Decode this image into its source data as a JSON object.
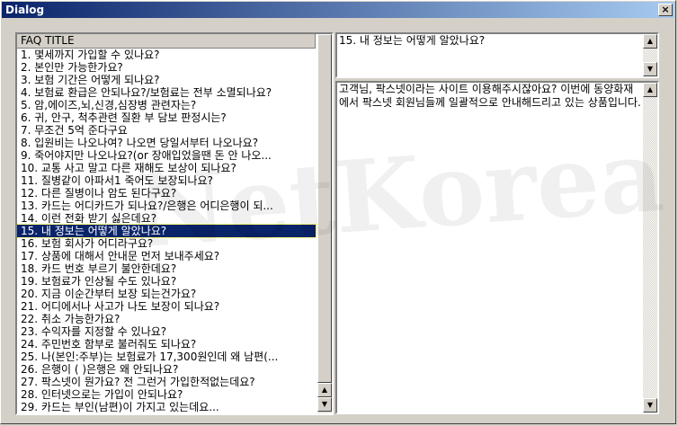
{
  "window": {
    "title": "Dialog",
    "close_glyph": "×"
  },
  "faq_list": {
    "header": "FAQ TITLE",
    "items": [
      "1. 몇세까지 가입할 수 있나요?",
      "2. 본인만 가능한가요?",
      "3. 보험 기간은 어떻게 되나요?",
      "4. 보험료 환급은 안되나요?/보험료는 전부 소멸되나요?",
      "5. 암,에이즈,뇌,신경,심장병 관련자는?",
      "6. 귀, 안구, 척추관련 질환 부 담보 판정시는?",
      "7. 무조건 5억 준다구요",
      "8. 입원비는 나오나여? 나오면 당일서부터 나오나요?",
      "9. 죽어야지만 나오나요?(or 장애입었을땐 돈 안 나오...",
      "10. 교통 사고 말고 다른 재해도 보상이 되나요?",
      "11. 질병같이 아파서1 죽어도 보장되나요?",
      "12. 다른 질병이나 암도 된다구요?",
      "13. 카드는 어디카드가 되나요?/은행은 어디은행이 되...",
      "14. 이런 전화 받기 싫은데요?",
      "15. 내 정보는 어떻게 알았나요?",
      "16. 보험 회사가 어디라구요?",
      "17. 상품에 대해서 안내문 먼저 보내주세요?",
      "18. 카드 번호 부르기 불안한데요?",
      "19. 보험료가 인상될 수도 있나요?",
      "20. 지금 이순간부터 보장 되는건가요?",
      "21. 어디에서나 사고가 나도 보장이 되나요?",
      "22. 취소 가능한가요?",
      "23. 수익자를 지정할 수 있나요?",
      "24. 주민번호 함부로 불러줘도 되나요?",
      "25. 나(본인:주부)는 보험료가 17,300원인데 왜 남편(...",
      "26. 은행이 (   )은행은 왜 안되나요?",
      "27. 팍스넷이 뭔가요? 전 그런거 가입한적없는데요?",
      "28. 인터넷으로는 가입이 안되나요?",
      "29. 카드는 부인(남편)이 가지고 있는데요..."
    ],
    "selected_index": 14
  },
  "question_box": {
    "text": "15. 내 정보는 어떻게 알았나요?"
  },
  "answer_box": {
    "text": "고객님, 팍스넷이라는 사이트 이용해주시잖아요? 이번에 동양화재에서 팍스넷 회원님들께 일괄적으로 안내해드리고 있는 상품입니다."
  },
  "watermark": {
    "text": "NetKorea"
  },
  "icons": {
    "scroll_up": "▲",
    "scroll_down": "▼"
  }
}
